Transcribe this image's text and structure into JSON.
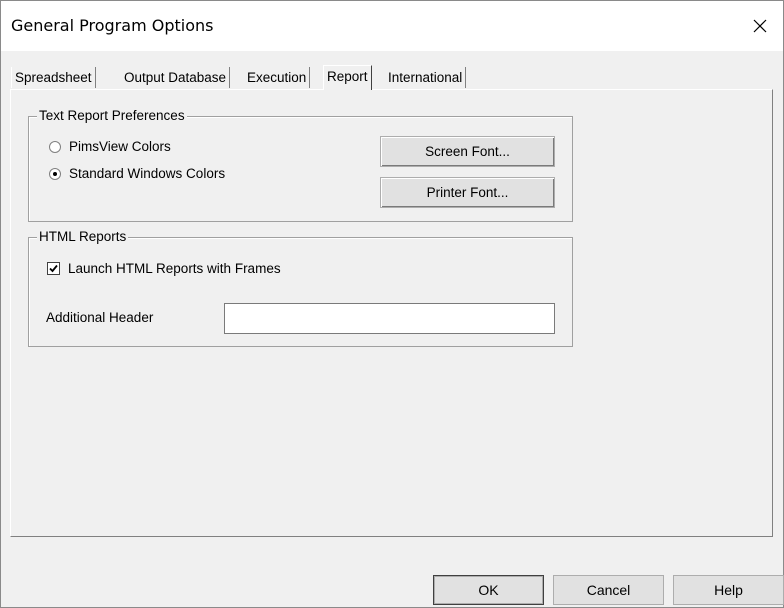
{
  "window": {
    "title": "General Program Options",
    "close_glyph": "✕"
  },
  "tabs": [
    {
      "label": "Spreadsheet",
      "active": false
    },
    {
      "label": "Output Database",
      "active": false
    },
    {
      "label": "Execution",
      "active": false
    },
    {
      "label": "Report",
      "active": true
    },
    {
      "label": "International",
      "active": false
    }
  ],
  "text_report_preferences": {
    "legend": "Text Report Preferences",
    "radio_pimsview": {
      "label": "PimsView Colors",
      "checked": false
    },
    "radio_standard": {
      "label": "Standard Windows Colors",
      "checked": true
    },
    "screen_font_button": "Screen Font...",
    "printer_font_button": "Printer Font..."
  },
  "html_reports": {
    "legend": "HTML Reports",
    "launch_with_frames": {
      "label": "Launch HTML Reports with Frames",
      "checked": true
    },
    "additional_header_label": "Additional Header",
    "additional_header_value": ""
  },
  "footer": {
    "ok_label": "OK",
    "cancel_label": "Cancel",
    "help_label": "Help"
  },
  "icons": {
    "close": "close-icon",
    "check": "check-icon"
  }
}
